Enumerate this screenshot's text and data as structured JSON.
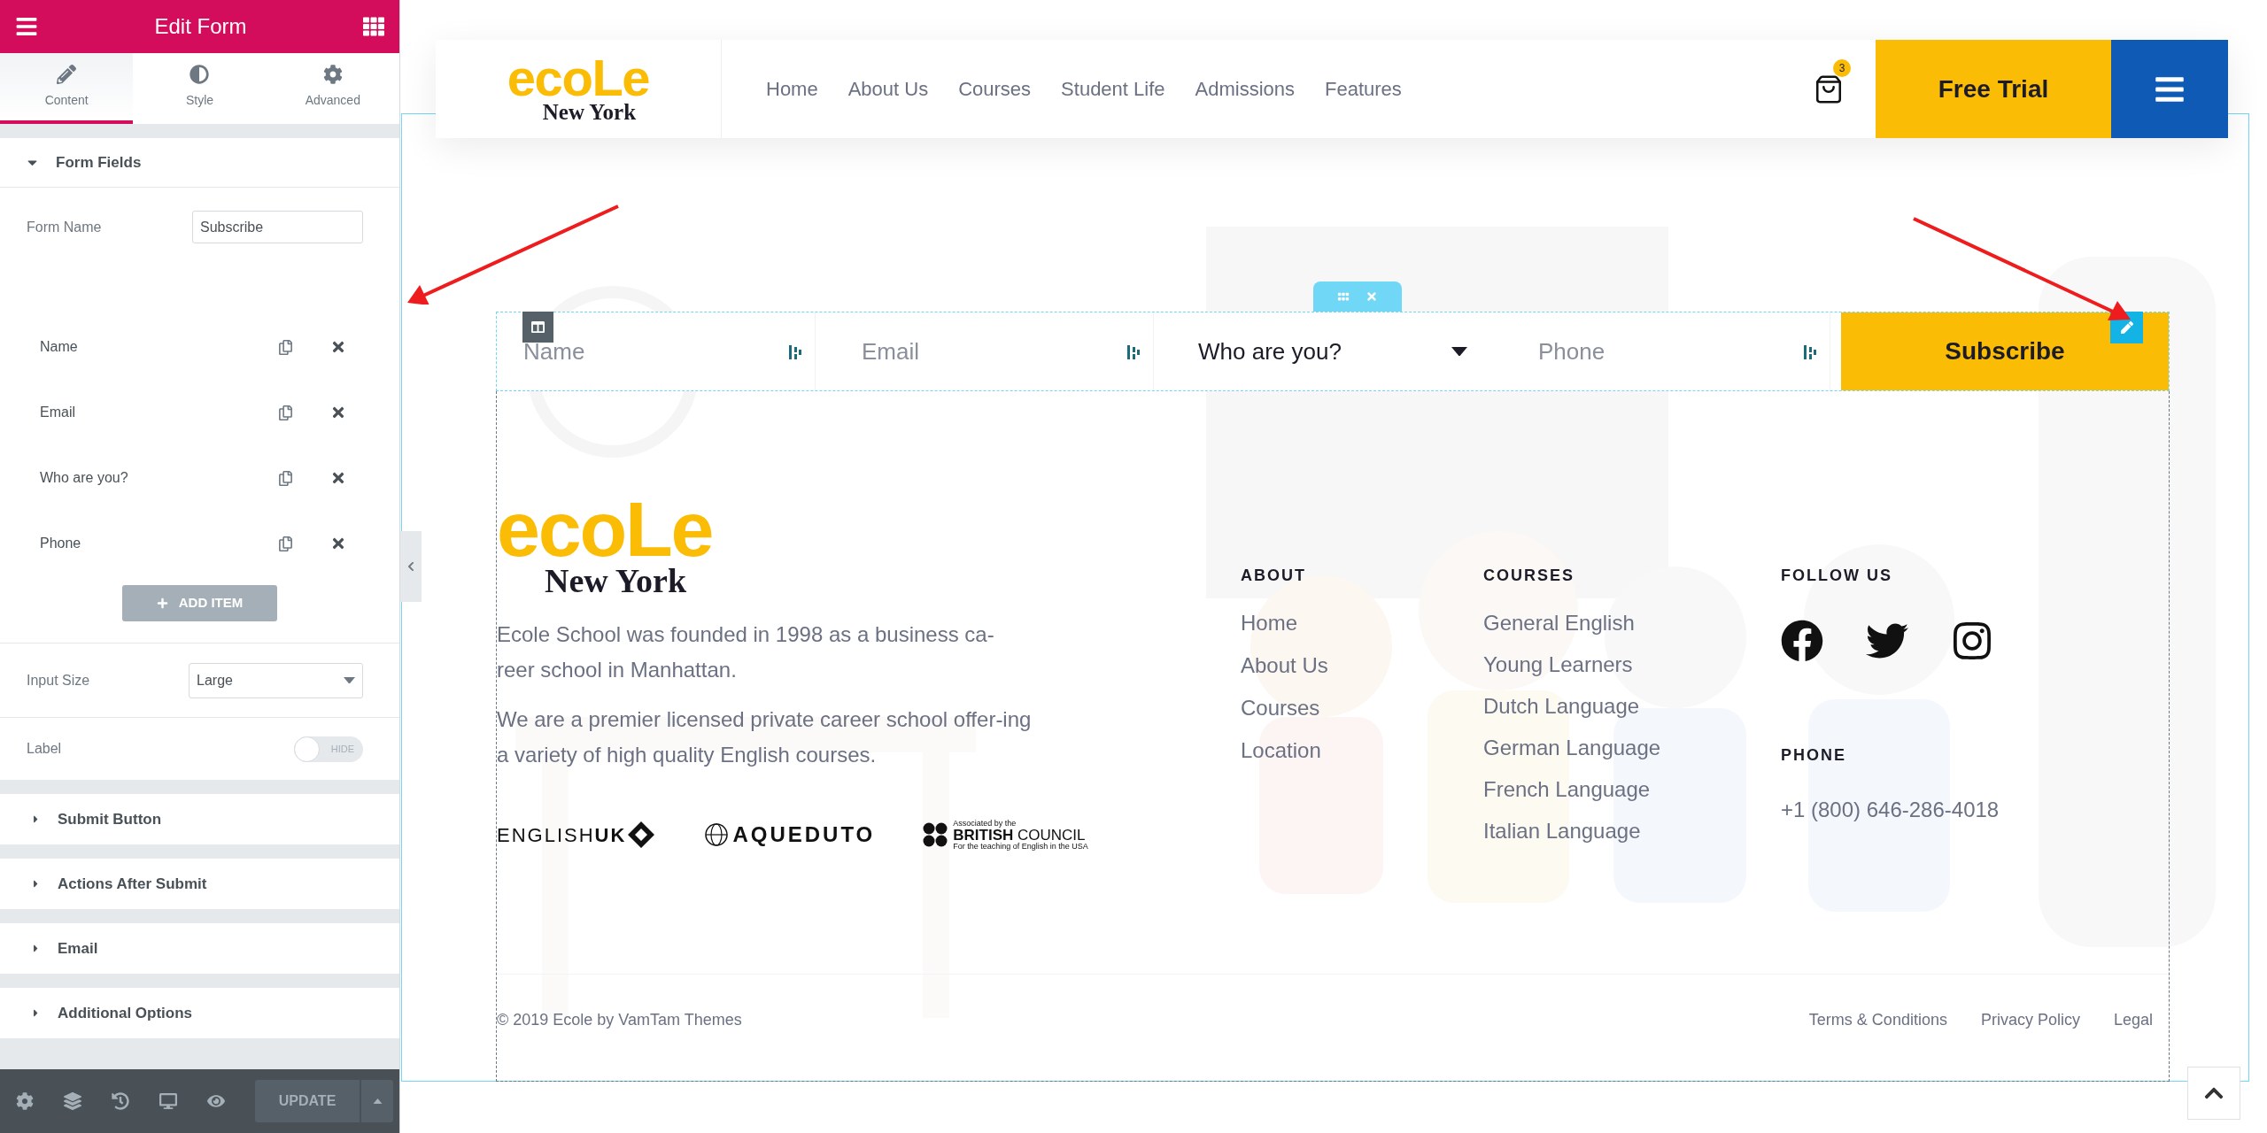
{
  "panel": {
    "title": "Edit Form",
    "tabs": [
      {
        "label": "Content",
        "kind": "pencil",
        "selected": true
      },
      {
        "label": "Style",
        "kind": "contrast",
        "selected": false
      },
      {
        "label": "Advanced",
        "kind": "gear",
        "selected": false
      }
    ],
    "form_fields": {
      "title": "Form Fields",
      "expanded": true,
      "form_name": {
        "label": "Form Name",
        "value": "Subscribe"
      },
      "items": [
        {
          "label": "Name"
        },
        {
          "label": "Email"
        },
        {
          "label": "Who are you?"
        },
        {
          "label": "Phone"
        }
      ],
      "add_button": "ADD ITEM",
      "input_size": {
        "label": "Input Size",
        "value": "Large"
      },
      "label_toggle": {
        "label": "Label",
        "on": false,
        "text": "HIDE"
      }
    },
    "sections": [
      {
        "title": "Submit Button",
        "expanded": false
      },
      {
        "title": "Actions After Submit",
        "expanded": false
      },
      {
        "title": "Email",
        "expanded": false
      },
      {
        "title": "Additional Options",
        "expanded": false
      }
    ],
    "update_button": "UPDATE"
  },
  "site": {
    "logo": {
      "word": "ecoLe",
      "city": "New York"
    },
    "nav": [
      "Home",
      "About Us",
      "Courses",
      "Student Life",
      "Admissions",
      "Features"
    ],
    "cart_count": "3",
    "cta": "Free Trial",
    "form": {
      "fields": [
        {
          "kind": "text",
          "placeholder": "Name"
        },
        {
          "kind": "text",
          "placeholder": "Email"
        },
        {
          "kind": "select",
          "value": "Who are you?"
        },
        {
          "kind": "text",
          "placeholder": "Phone"
        }
      ],
      "submit": "Subscribe"
    },
    "footer": {
      "logo": {
        "word": "ecoLe",
        "city": "New York"
      },
      "paragraphs": [
        "Ecole School was founded in 1998 as a business ca-reer school in Manhattan.",
        "We are a premier licensed private career school offer-ing a variety of high quality English courses."
      ],
      "partners": {
        "english_uk": {
          "light": "ENGLISH",
          "bold": "UK"
        },
        "aqueduto": "AQUEDUTO",
        "british_council": {
          "top": "Associated by the",
          "bold": "BRITISH",
          "light": "COUNCIL",
          "bottom": "For the teaching of English in the USA"
        }
      },
      "about": {
        "title": "ABOUT",
        "links": [
          "Home",
          "About Us",
          "Courses",
          "Location"
        ]
      },
      "courses": {
        "title": "COURSES",
        "links": [
          "General English",
          "Young Learners",
          "Dutch Language",
          "German Language",
          "French Language",
          "Italian Language"
        ]
      },
      "follow": {
        "title": "FOLLOW US"
      },
      "phone": {
        "title": "PHONE",
        "number": "+1 (800) 646-286-4018"
      },
      "copyright": "© 2019 Ecole by VamTam Themes",
      "legal_links": [
        "Terms & Conditions",
        "Privacy Policy",
        "Legal"
      ]
    }
  }
}
